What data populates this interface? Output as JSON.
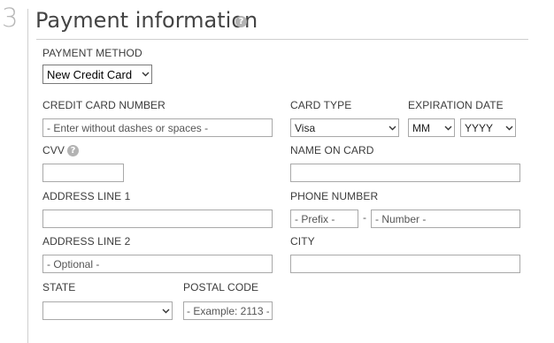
{
  "step": {
    "number": "3"
  },
  "section": {
    "title": "Payment information"
  },
  "payment_method": {
    "label": "PAYMENT METHOD",
    "selected": "New Credit Card"
  },
  "credit_card_number": {
    "label": "CREDIT CARD NUMBER",
    "placeholder": "- Enter without dashes or spaces -"
  },
  "card_type": {
    "label": "CARD TYPE",
    "selected": "Visa"
  },
  "expiration": {
    "label": "EXPIRATION DATE",
    "month": "MM",
    "year": "YYYY"
  },
  "cvv": {
    "label": "CVV"
  },
  "name_on_card": {
    "label": "NAME ON CARD"
  },
  "address_line_1": {
    "label": "ADDRESS LINE 1"
  },
  "phone_number": {
    "label": "PHONE NUMBER",
    "prefix_placeholder": "- Prefix -",
    "separator": "-",
    "number_placeholder": "- Number -"
  },
  "address_line_2": {
    "label": "ADDRESS LINE 2",
    "placeholder": "- Optional -"
  },
  "city": {
    "label": "CITY"
  },
  "state": {
    "label": "STATE",
    "selected": ""
  },
  "postal_code": {
    "label": "POSTAL CODE",
    "placeholder": "- Example: 2113 -"
  },
  "icons": {
    "help": "question-mark-circle-icon",
    "dropdown": "chevron-down-icon"
  },
  "colors": {
    "rule": "#cfcfcf",
    "help_icon": "#b3b3b3",
    "field_border": "#a9a9a9"
  }
}
